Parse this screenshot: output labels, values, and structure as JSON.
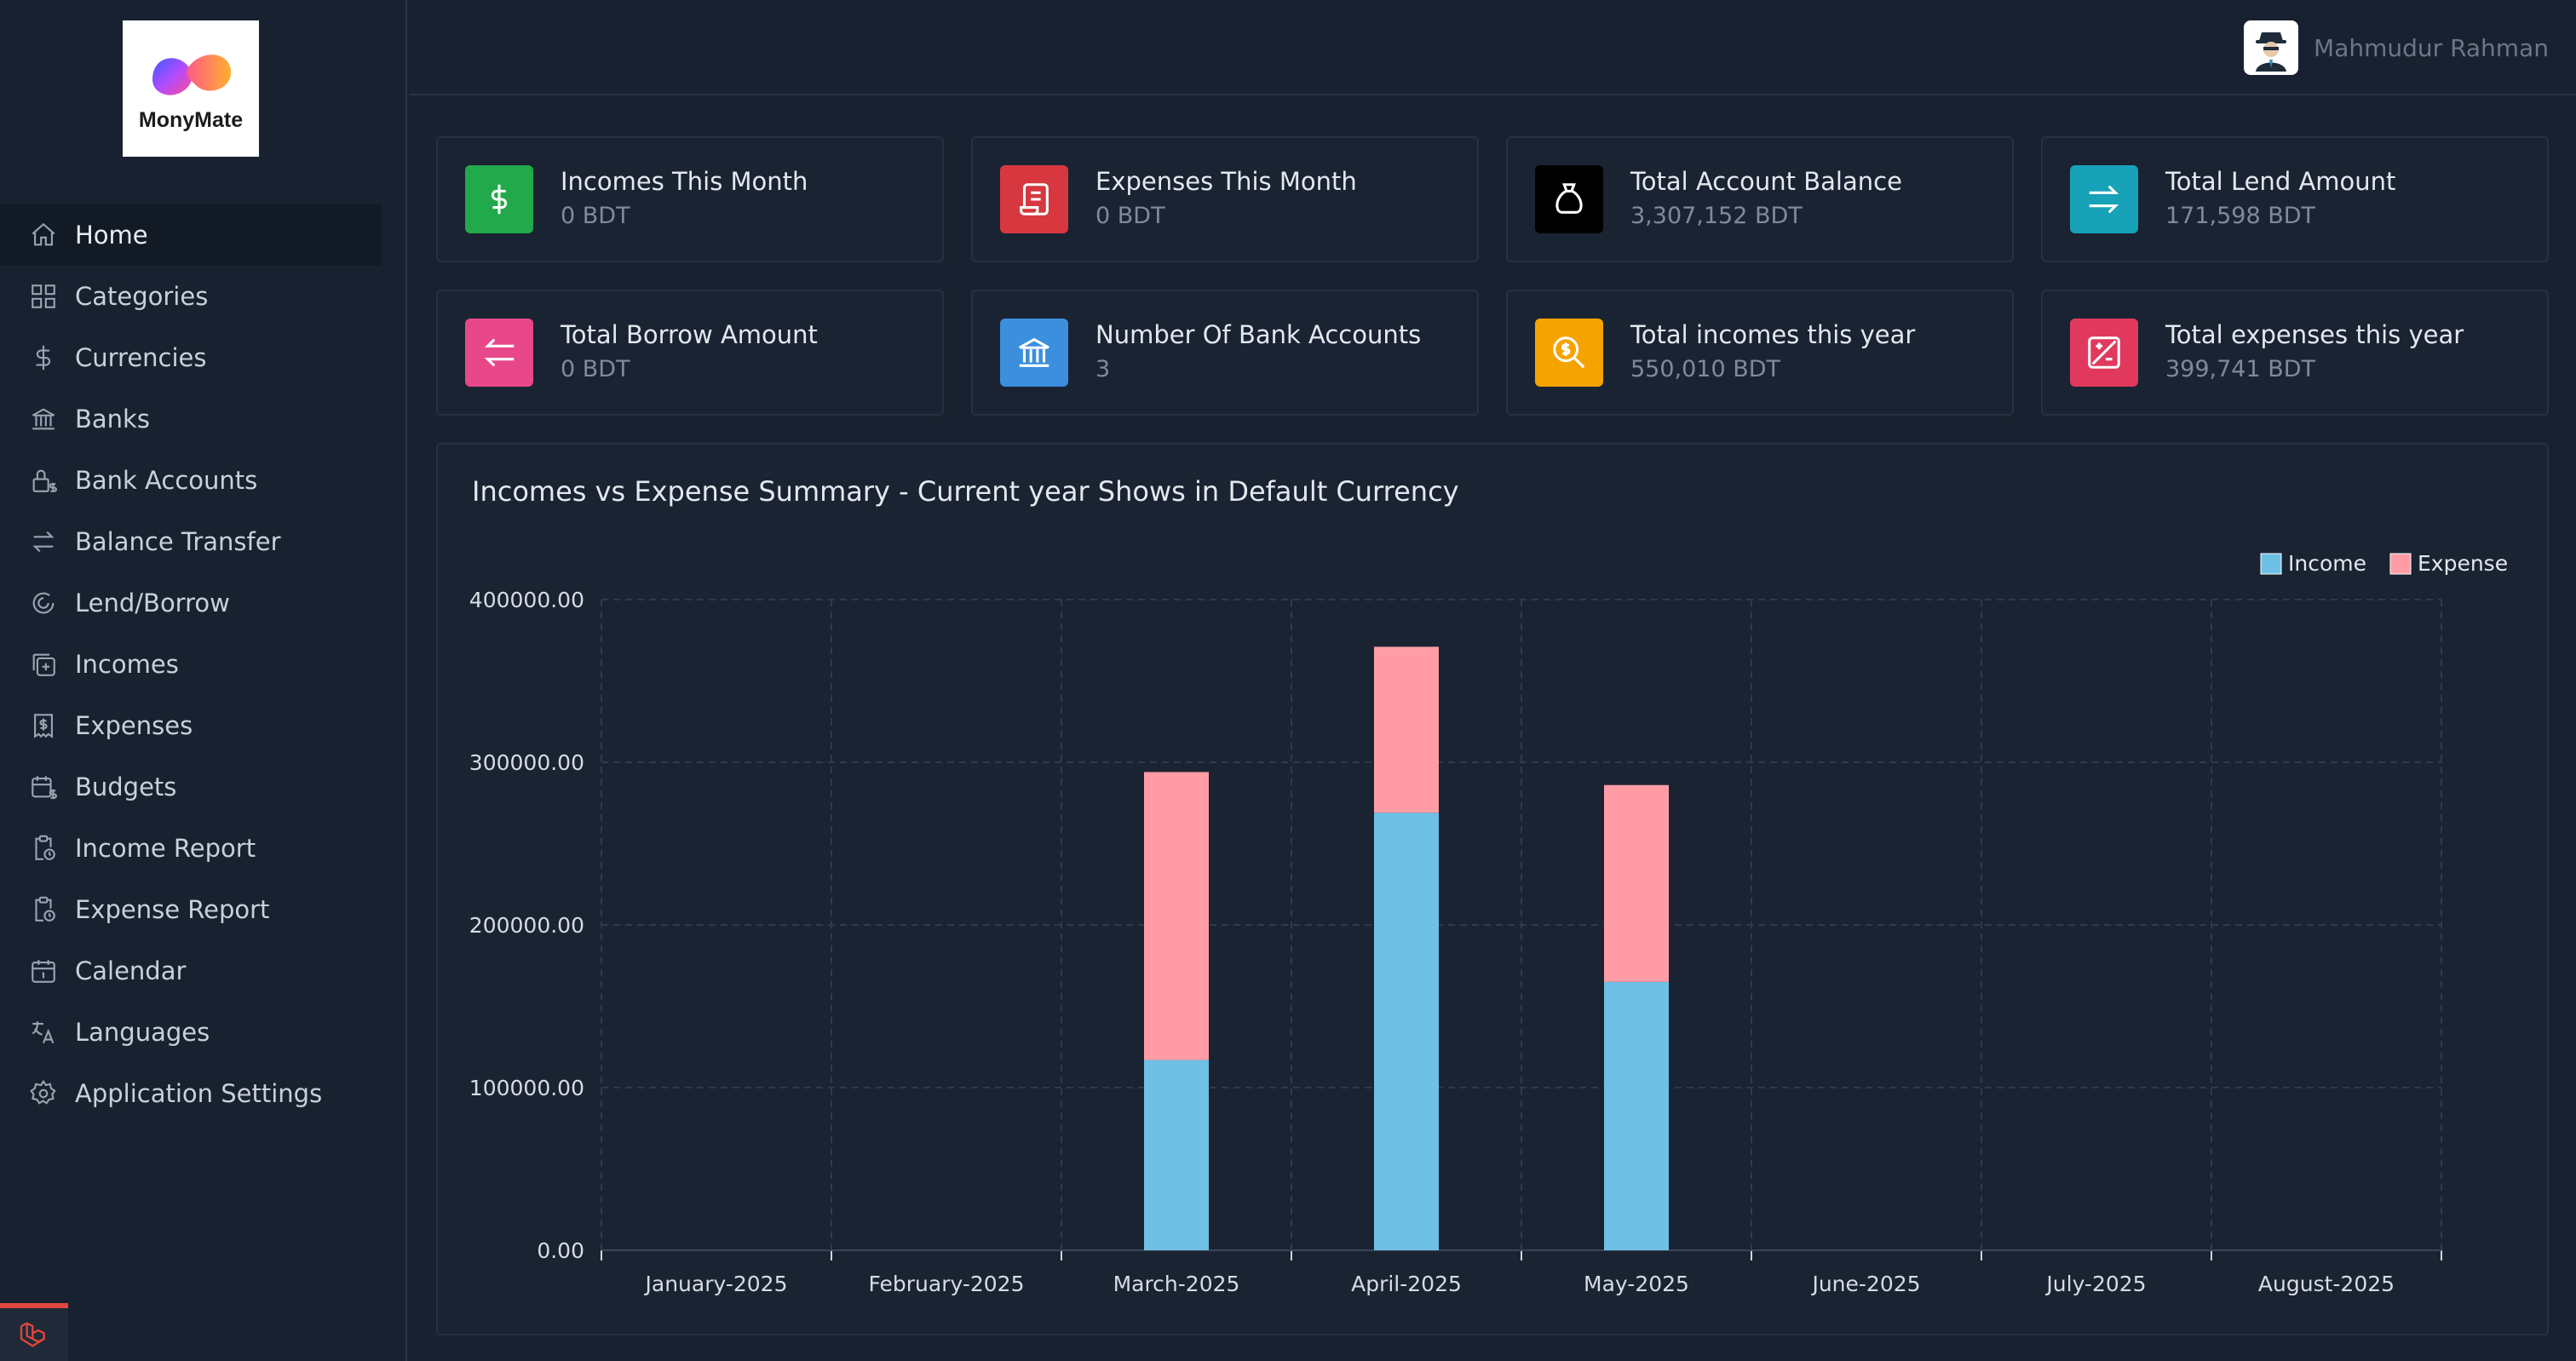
{
  "app": {
    "brand": "MonyMate"
  },
  "user": {
    "name": "Mahmudur Rahman"
  },
  "sidebar": {
    "items": [
      {
        "label": "Home",
        "icon": "home-icon",
        "active": true
      },
      {
        "label": "Categories",
        "icon": "grid-icon"
      },
      {
        "label": "Currencies",
        "icon": "dollar-icon"
      },
      {
        "label": "Banks",
        "icon": "bank-icon"
      },
      {
        "label": "Bank Accounts",
        "icon": "lock-dollar-icon"
      },
      {
        "label": "Balance Transfer",
        "icon": "transfer-icon"
      },
      {
        "label": "Lend/Borrow",
        "icon": "cycle-icon"
      },
      {
        "label": "Incomes",
        "icon": "plus-square-icon"
      },
      {
        "label": "Expenses",
        "icon": "receipt-dollar-icon"
      },
      {
        "label": "Budgets",
        "icon": "calendar-dollar-icon"
      },
      {
        "label": "Income Report",
        "icon": "clipboard-clock-icon"
      },
      {
        "label": "Expense Report",
        "icon": "clipboard-clock-icon"
      },
      {
        "label": "Calendar",
        "icon": "calendar-icon"
      },
      {
        "label": "Languages",
        "icon": "translate-icon"
      },
      {
        "label": "Application Settings",
        "icon": "gear-icon"
      }
    ]
  },
  "stats": [
    {
      "title": "Incomes This Month",
      "value": "0 BDT",
      "color": "#22a94b",
      "icon": "dollar-icon"
    },
    {
      "title": "Expenses This Month",
      "value": "0 BDT",
      "color": "#d7373f",
      "icon": "receipt-icon"
    },
    {
      "title": "Total Account Balance",
      "value": "3,307,152 BDT",
      "color": "#000000",
      "icon": "money-bag-icon"
    },
    {
      "title": "Total Lend Amount",
      "value": "171,598 BDT",
      "color": "#17a2b8",
      "icon": "arrows-right-icon"
    },
    {
      "title": "Total Borrow Amount",
      "value": "0 BDT",
      "color": "#e8488a",
      "icon": "arrows-left-icon"
    },
    {
      "title": "Number Of Bank Accounts",
      "value": "3",
      "color": "#3b8fdd",
      "icon": "bank-icon"
    },
    {
      "title": "Total incomes this year",
      "value": "550,010 BDT",
      "color": "#f5a300",
      "icon": "search-dollar-icon"
    },
    {
      "title": "Total expenses this year",
      "value": "399,741 BDT",
      "color": "#e0395d",
      "icon": "plus-minus-icon"
    }
  ],
  "chart_title": "Incomes vs Expense Summary - Current year Shows in Default Currency",
  "chart_data": {
    "type": "bar",
    "stacked": true,
    "categories": [
      "January-2025",
      "February-2025",
      "March-2025",
      "April-2025",
      "May-2025",
      "June-2025",
      "July-2025",
      "August-2025"
    ],
    "series": [
      {
        "name": "Income",
        "color": "#6ec0e4",
        "values": [
          0,
          0,
          117000,
          269000,
          165000,
          0,
          0,
          0
        ]
      },
      {
        "name": "Expense",
        "color": "#ff9ca6",
        "values": [
          0,
          0,
          177000,
          102000,
          121000,
          0,
          0,
          0
        ]
      }
    ],
    "ylim": [
      0,
      400000
    ],
    "yticks": [
      "0.00",
      "100000.00",
      "200000.00",
      "300000.00",
      "400000.00"
    ],
    "ytick_values": [
      0,
      100000,
      200000,
      300000,
      400000
    ],
    "grid": true,
    "legend": "top-right"
  }
}
